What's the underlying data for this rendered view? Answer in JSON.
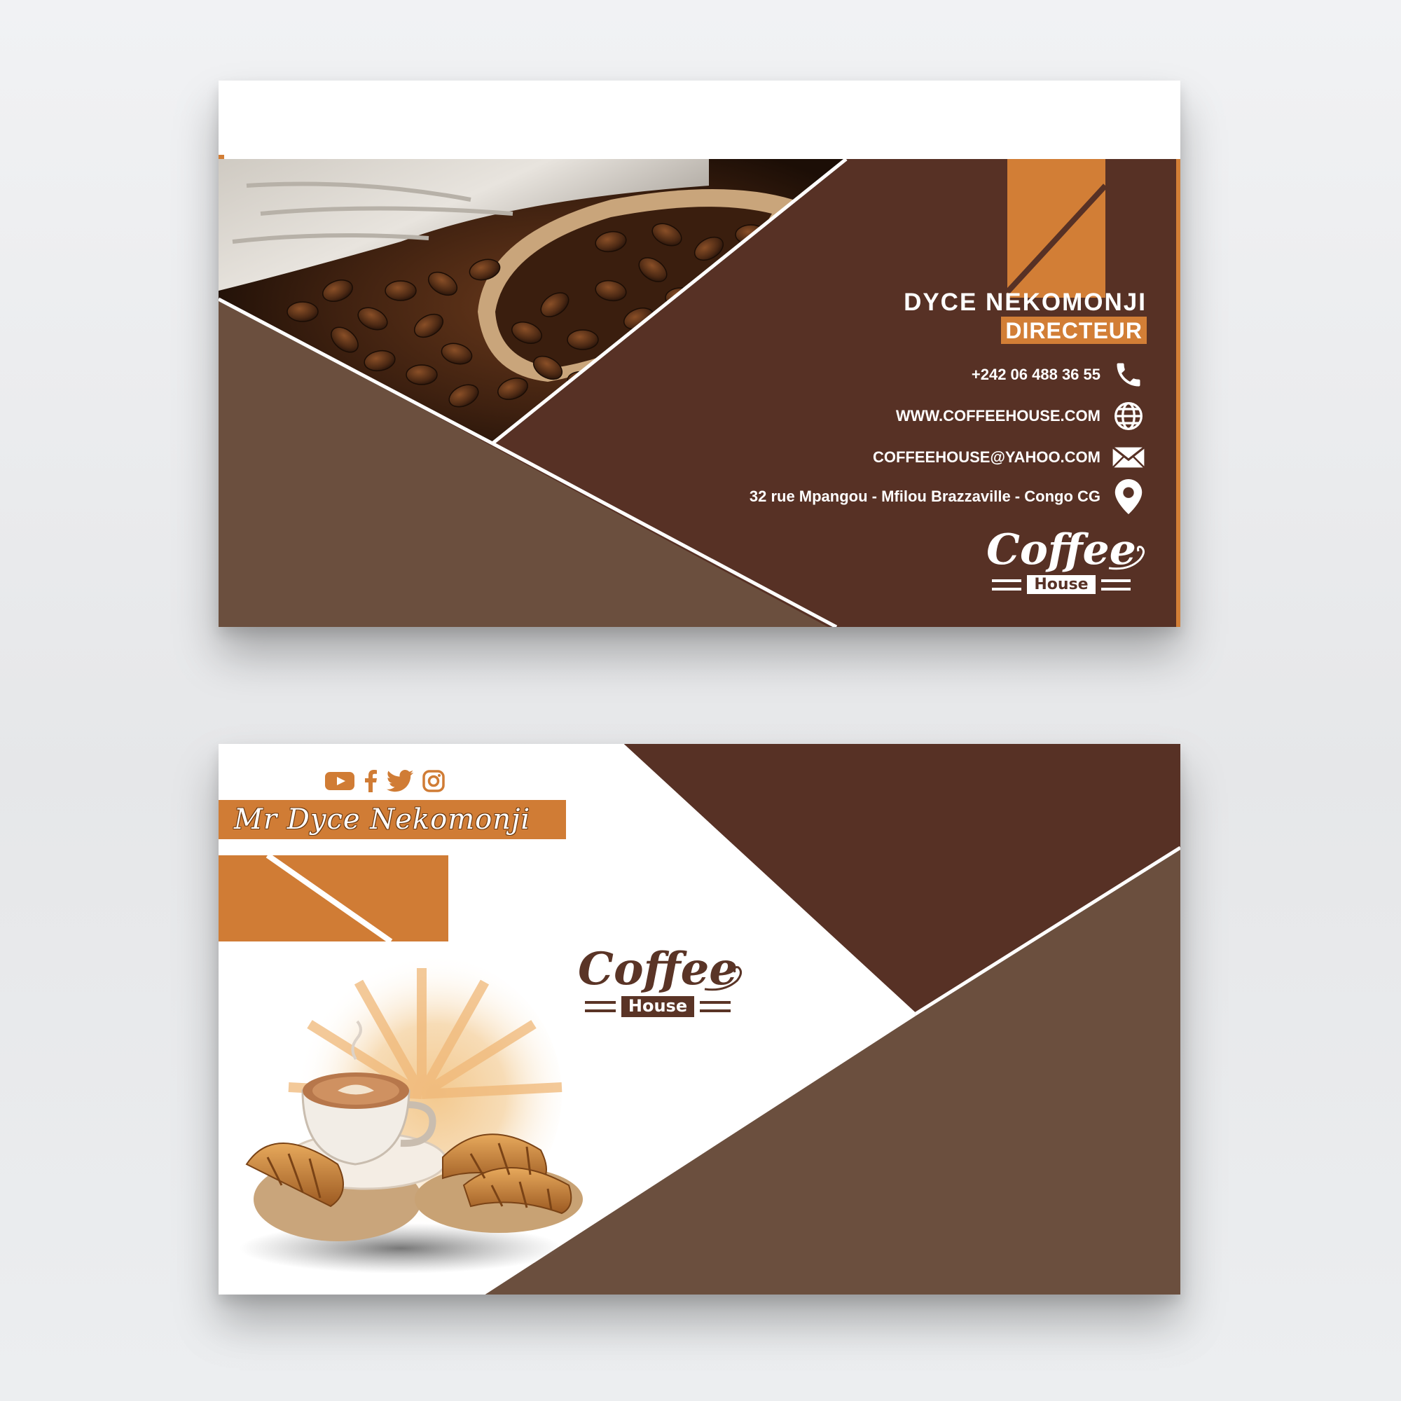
{
  "front_card": {
    "name": "DYCE NEKOMONJI",
    "title": "DIRECTEUR",
    "contacts": [
      {
        "text": "+242 06 488 36 55",
        "icon": "phone-icon"
      },
      {
        "text": "WWW.COFFEEHOUSE.COM",
        "icon": "globe-icon"
      },
      {
        "text": "COFFEEHOUSE@YAHOO.COM",
        "icon": "envelope-icon"
      },
      {
        "text": "32 rue Mpangou - Mfilou Brazzaville - Congo CG",
        "icon": "location-pin-icon"
      }
    ],
    "logo": {
      "word": "Coffee",
      "sub": "House"
    }
  },
  "back_card": {
    "social_icons": [
      "youtube-icon",
      "facebook-icon",
      "twitter-icon",
      "instagram-icon"
    ],
    "script_name": "Mr Dyce Nekomonji",
    "logo": {
      "word": "Coffee",
      "sub": "House"
    }
  },
  "colors": {
    "dark_brown": "#573125",
    "mid_brown": "#6b4f3e",
    "accent_orange": "#d27e36",
    "white": "#ffffff"
  }
}
